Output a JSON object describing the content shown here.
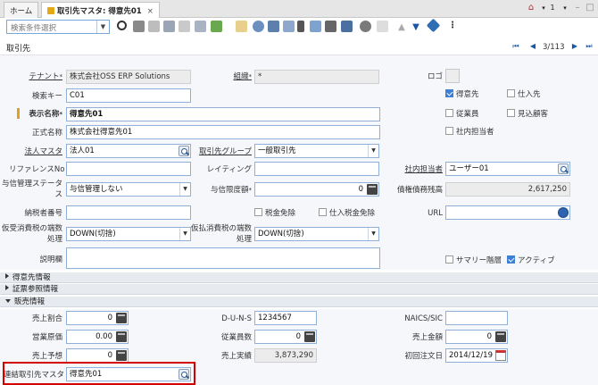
{
  "tabs": {
    "home": "ホーム",
    "active": "取引先マスタ: 得意先01"
  },
  "topright": {
    "count": "1"
  },
  "search": {
    "placeholder": "検索条件選択"
  },
  "titlebar": {
    "title": "取引先",
    "record_pos": "3/113"
  },
  "form": {
    "tenant": {
      "label": "テナント",
      "value": "株式会社OSS ERP Solutions"
    },
    "org": {
      "label": "組織",
      "value": "*"
    },
    "logo": {
      "label": "ロゴ"
    },
    "searchkey": {
      "label": "検索キー",
      "value": "C01"
    },
    "displayname": {
      "label": "表示名称",
      "value": "得意先01"
    },
    "formalname": {
      "label": "正式名称",
      "value": "株式会社得意先01"
    },
    "corpmaster": {
      "label": "法人マスタ",
      "value": "法人01"
    },
    "bpgroup": {
      "label": "取引先グループ",
      "value": "一般取引先"
    },
    "referenceno": {
      "label": "リファレンスNo",
      "value": ""
    },
    "rating": {
      "label": "レイティング",
      "value": ""
    },
    "salesrep": {
      "label": "社内担当者",
      "value": "ユーザー01"
    },
    "creditstatus": {
      "label": "与信管理ステータス",
      "value": "与信管理しない"
    },
    "creditlimit": {
      "label": "与信限度額",
      "value": "0"
    },
    "receivable": {
      "label": "債権債務残高",
      "value": "2,617,250"
    },
    "taxid": {
      "label": "納税者番号",
      "value": ""
    },
    "taxexempt": {
      "label": "税金免除"
    },
    "potaxexempt": {
      "label": "仕入税金免除"
    },
    "url": {
      "label": "URL",
      "value": ""
    },
    "receivetax": {
      "label": "仮受消費税の端数処理",
      "value": "DOWN(切捨)"
    },
    "paytax": {
      "label": "仮払消費税の端数処理",
      "value": "DOWN(切捨)"
    },
    "description": {
      "label": "説明欄",
      "value": ""
    }
  },
  "checkboxes": {
    "customer": {
      "label": "得意先",
      "checked": true
    },
    "vendor": {
      "label": "仕入先",
      "checked": false
    },
    "employee": {
      "label": "従業員",
      "checked": false
    },
    "prospect": {
      "label": "見込顧客",
      "checked": false
    },
    "salesrep": {
      "label": "社内担当者",
      "checked": false
    },
    "summary": {
      "label": "サマリー階層",
      "checked": false
    },
    "active": {
      "label": "アクティブ",
      "checked": true
    }
  },
  "sections": {
    "customer_info": "得意先情報",
    "ref_info": "証票参照情報",
    "sales_info": "販売情報"
  },
  "sales": {
    "sharepct": {
      "label": "売上割合",
      "value": "0"
    },
    "duns": {
      "label": "D-U-N-S",
      "value": "1234567"
    },
    "naics": {
      "label": "NAICS/SIC",
      "value": ""
    },
    "salescost": {
      "label": "営業原価",
      "value": "0.00"
    },
    "employees": {
      "label": "従業員数",
      "value": "0"
    },
    "salesvolume": {
      "label": "売上金額",
      "value": "0"
    },
    "potential": {
      "label": "売上予想",
      "value": "0"
    },
    "actual": {
      "label": "売上実績",
      "value": "3,873,290"
    },
    "firstsale": {
      "label": "初回注文日",
      "value": "2014/12/19"
    },
    "linkedbp": {
      "label": "連結取引先マスタ",
      "value": "得意先01"
    }
  },
  "colors": {
    "accent": "#3d7fd6",
    "highlight": "#d40000",
    "section_bg": "#e7ebf0"
  }
}
